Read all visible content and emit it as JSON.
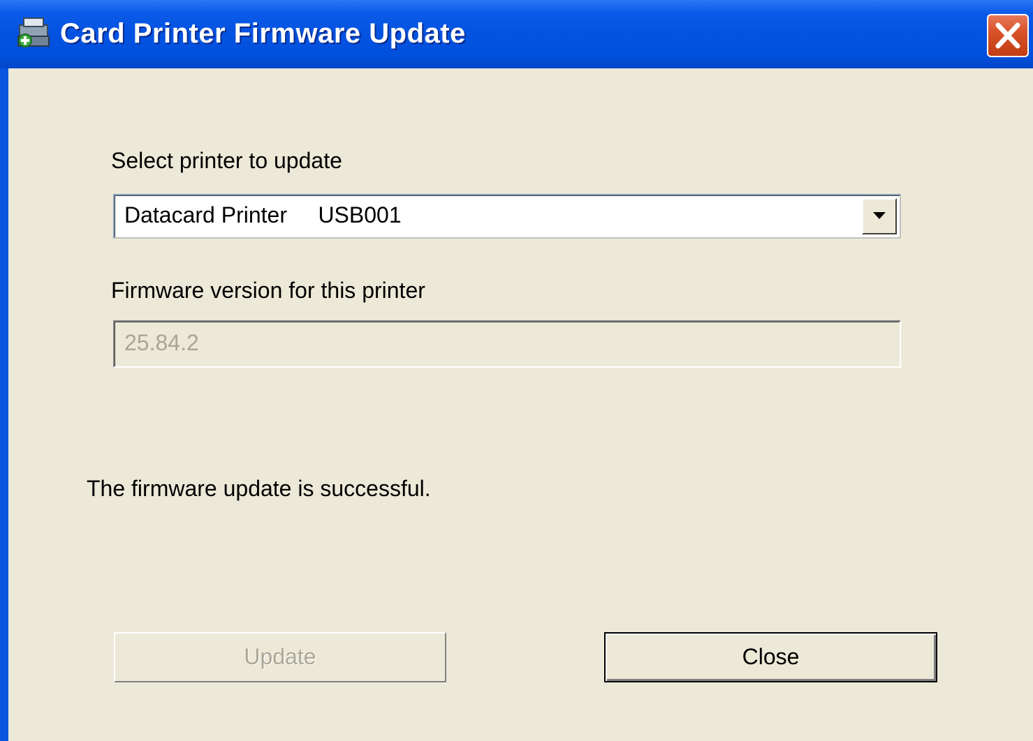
{
  "window": {
    "title": "Card Printer Firmware Update",
    "title_icon": "printer-update-icon",
    "close_icon": "close-icon"
  },
  "printer_select": {
    "label": "Select printer to update",
    "selected_value": "Datacard Printer     USB001",
    "dropdown_icon": "chevron-down-icon"
  },
  "firmware": {
    "label": "Firmware version for this printer",
    "value": "25.84.2"
  },
  "status": {
    "message": "The firmware update is successful."
  },
  "buttons": {
    "update_label": "Update",
    "close_label": "Close"
  },
  "colors": {
    "titlebar": "#0553e1",
    "dialog_background": "#ece9d8",
    "close_button": "#d8522a"
  }
}
